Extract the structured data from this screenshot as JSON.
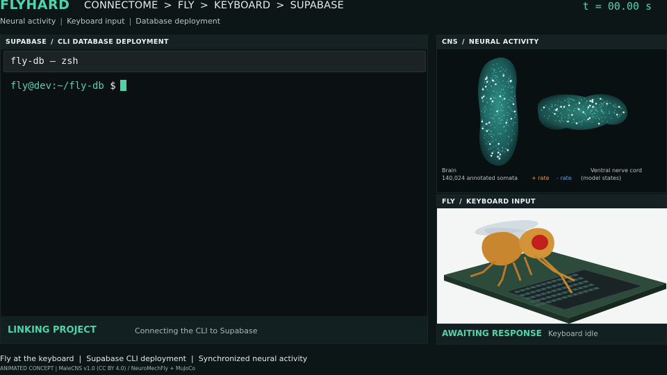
{
  "header": {
    "brand": "FLYHARD",
    "breadcrumb": [
      "CONNECTOME",
      "FLY",
      "KEYBOARD",
      "SUPABASE"
    ],
    "breadcrumb_sep": ">",
    "timer": "t = 00.00 s"
  },
  "subnav": {
    "items": [
      "Neural activity",
      "Keyboard input",
      "Database deployment"
    ],
    "sep": "|"
  },
  "terminal_panel": {
    "title_a": "SUPABASE",
    "title_b": "CLI DATABASE DEPLOYMENT",
    "sep": "/",
    "tab_title": "fly-db — zsh",
    "prompt": "fly@dev:~/fly-db",
    "prompt_symbol": "$"
  },
  "terminal_status": {
    "title": "LINKING PROJECT",
    "text": "Connecting the CLI to Supabase"
  },
  "cns_panel": {
    "title_a": "CNS",
    "title_b": "NEURAL ACTIVITY",
    "sep": "/",
    "brain_label": "Brain",
    "brain_count": "140,024 annotated somata",
    "rate_pos": "+ rate",
    "rate_neg": "- rate",
    "vnc_label": "Ventral nerve cord",
    "vnc_note": "(model states)"
  },
  "fly_panel": {
    "title_a": "FLY",
    "title_b": "KEYBOARD INPUT",
    "sep": "/"
  },
  "fly_status": {
    "title": "AWAITING RESPONSE",
    "text": "Keyboard idle"
  },
  "footer": {
    "items": [
      "Fly at the keyboard",
      "Supabase CLI deployment",
      "Synchronized neural activity"
    ],
    "sep": "|",
    "credits": "ANIMATED CONCEPT | MaleCNS v1.0 (CC BY 4.0) / NeuroMechFly + MuJoCo"
  },
  "colors": {
    "accent": "#4fd3a7",
    "rate_pos": "#e79b43",
    "rate_neg": "#4aa6e0",
    "background": "#0d1617"
  }
}
